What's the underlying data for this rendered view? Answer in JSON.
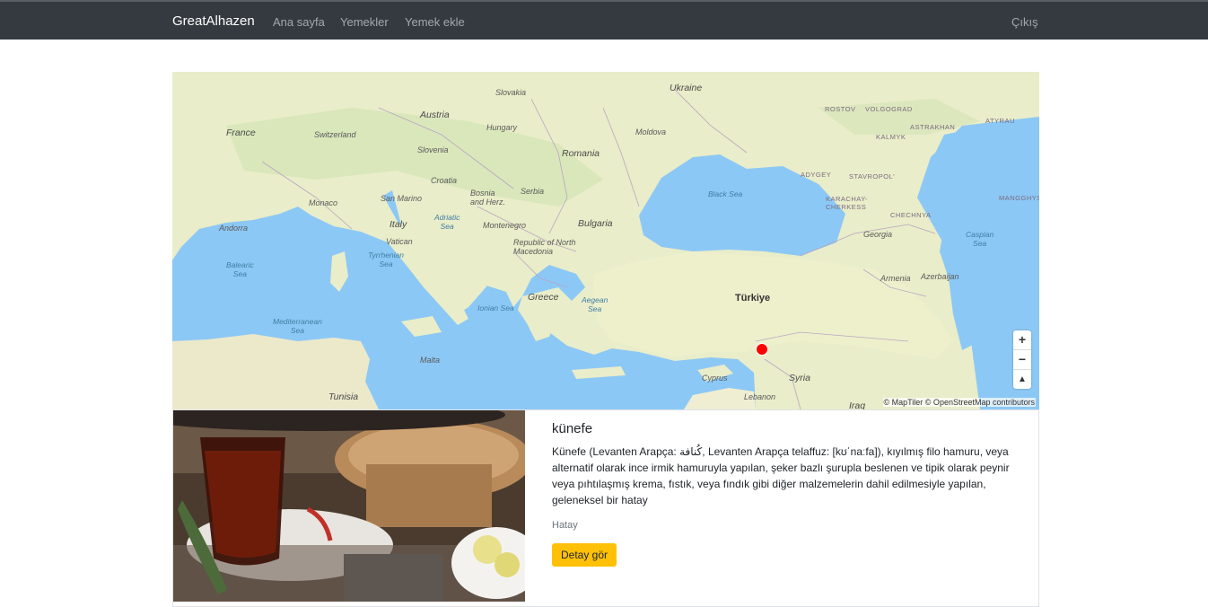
{
  "navbar": {
    "brand": "GreatAlhazen",
    "links": [
      "Ana sayfa",
      "Yemekler",
      "Yemek ekle"
    ],
    "logout": "Çıkış"
  },
  "map": {
    "labels": {
      "ukraine": "Ukraine",
      "slovakia": "Slovakia",
      "austria": "Austria",
      "hungary": "Hungary",
      "moldova": "Moldova",
      "france": "France",
      "switzerland": "Switzerland",
      "slovenia": "Slovenia",
      "croatia": "Croatia",
      "romania": "Romania",
      "serbia": "Serbia",
      "bosnia": "Bosnia\nand Herz.",
      "monaco": "Monaco",
      "san_marino": "San Marino",
      "italy": "Italy",
      "vatican": "Vatican",
      "adriatic": "Adriatic\nSea",
      "montenegro": "Montenegro",
      "bulgaria": "Bulgaria",
      "north_macedonia": "Republic of North\nMacedonia",
      "andorra": "Andorra",
      "balearic": "Balearic\nSea",
      "tyrrhenian": "Tyrrhenian\nSea",
      "greece": "Greece",
      "ionian": "Ionian Sea",
      "aegean": "Aegean\nSea",
      "mediterranean": "Mediterranean\nSea",
      "malta": "Malta",
      "tunisia": "Tunisia",
      "black_sea": "Black Sea",
      "turkiye": "Türkiye",
      "cyprus": "Cyprus",
      "lebanon": "Lebanon",
      "syria": "Syria",
      "iraq": "Iraq",
      "rostov": "ROSTOV",
      "volgograd": "VOLGOGRAD",
      "astrakhan": "ASTRAKHAN",
      "atyrau": "ATYRAU",
      "kalmyk": "KALMYK",
      "adygey": "ADYGEY",
      "stavropol": "STAVROPOL'",
      "karachay": "KARACHAY-\nCHERKESS",
      "chechnya": "CHECHNYA",
      "mangghys": "MANGGHYS",
      "georgia": "Georgia",
      "caspian": "Caspian\nSea",
      "armenia": "Armenia",
      "azerbaijan": "Azerbaijan"
    },
    "controls": {
      "zoom_in": "+",
      "zoom_out": "−",
      "compass": "▲"
    },
    "attribution": "© MapTiler © OpenStreetMap contributors",
    "marker_color": "#ff0000"
  },
  "card": {
    "title": "künefe",
    "description": "Künefe (Levanten Arapça: كُنافة, Levanten Arapça telaffuz: [kʊˈnaːfa]), kıyılmış filo hamuru, veya alternatif olarak ince irmik hamuruyla yapılan, şeker bazlı şurupla beslenen ve tipik olarak peynir veya pıhtılaşmış krema, fıstık, veya fındık gibi diğer malzemelerin dahil edilmesiyle yapılan, geleneksel bir hatay",
    "city": "Hatay",
    "button": "Detay gör"
  },
  "colors": {
    "navbar": "#343a40",
    "button": "#ffc107",
    "water": "#8cc8f5",
    "land": "#e8ecc8"
  }
}
